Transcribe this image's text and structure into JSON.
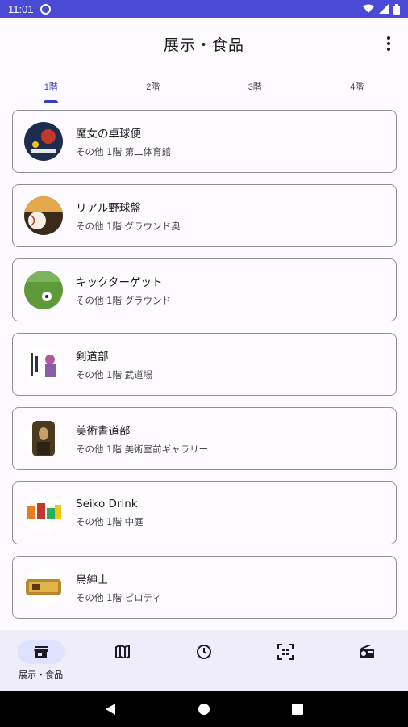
{
  "status_bar": {
    "time": "11:01"
  },
  "app_bar": {
    "title": "展示・食品"
  },
  "tabs": [
    {
      "label": "1階",
      "active": true
    },
    {
      "label": "2階",
      "active": false
    },
    {
      "label": "3階",
      "active": false
    },
    {
      "label": "4階",
      "active": false
    }
  ],
  "items": [
    {
      "title": "魔女の卓球便",
      "subtitle": "その他 1階 第二体育館"
    },
    {
      "title": "リアル野球盤",
      "subtitle": "その他 1階 グラウンド奥"
    },
    {
      "title": "キックターゲット",
      "subtitle": "その他 1階 グラウンド"
    },
    {
      "title": "剣道部",
      "subtitle": "その他 1階 武道場"
    },
    {
      "title": "美術書道部",
      "subtitle": "その他 1階 美術室前ギャラリー"
    },
    {
      "title": "Seiko Drink",
      "subtitle": "その他 1階 中庭"
    },
    {
      "title": "烏紳士",
      "subtitle": "その他 1階 ピロティ"
    }
  ],
  "bottom_nav": [
    {
      "icon": "storefront-icon",
      "label": "展示・食品",
      "active": true
    },
    {
      "icon": "map-icon",
      "label": "",
      "active": false
    },
    {
      "icon": "clock-icon",
      "label": "",
      "active": false
    },
    {
      "icon": "qr-scan-icon",
      "label": "",
      "active": false
    },
    {
      "icon": "radio-icon",
      "label": "",
      "active": false
    }
  ],
  "colors": {
    "accent": "#3f3fb8",
    "status_bar": "#4a4ad6",
    "nav_bg": "#efedf9",
    "nav_pill": "#e0e0ff"
  }
}
